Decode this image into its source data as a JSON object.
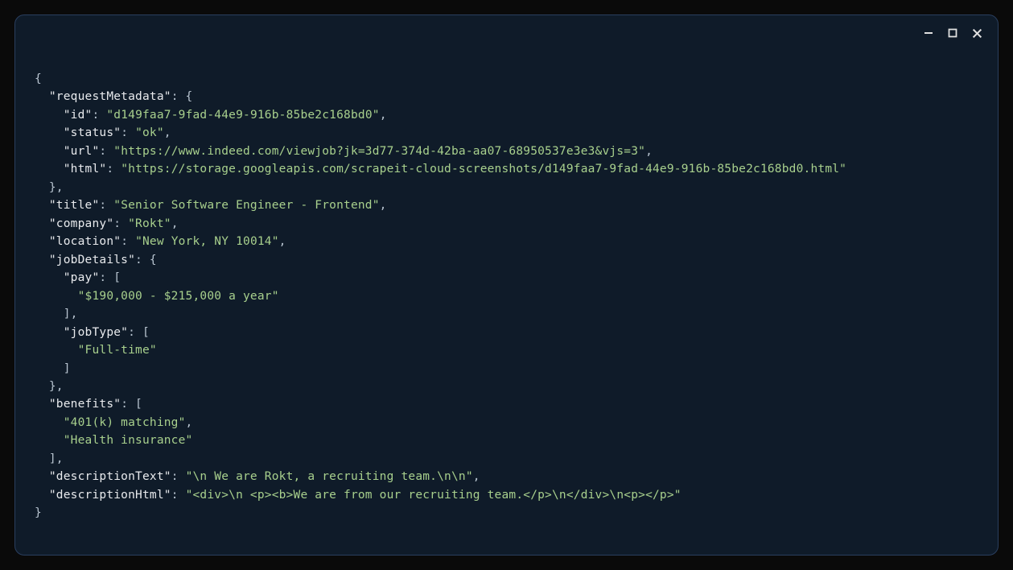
{
  "code": {
    "lines": [
      {
        "indent": 0,
        "segments": [
          {
            "type": "punct",
            "text": "{"
          }
        ]
      },
      {
        "indent": 1,
        "segments": [
          {
            "type": "key",
            "text": "\"requestMetadata\""
          },
          {
            "type": "punct",
            "text": ": {"
          }
        ]
      },
      {
        "indent": 2,
        "segments": [
          {
            "type": "key",
            "text": "\"id\""
          },
          {
            "type": "punct",
            "text": ": "
          },
          {
            "type": "string",
            "text": "\"d149faa7-9fad-44e9-916b-85be2c168bd0\""
          },
          {
            "type": "punct",
            "text": ","
          }
        ]
      },
      {
        "indent": 2,
        "segments": [
          {
            "type": "key",
            "text": "\"status\""
          },
          {
            "type": "punct",
            "text": ": "
          },
          {
            "type": "string",
            "text": "\"ok\""
          },
          {
            "type": "punct",
            "text": ","
          }
        ]
      },
      {
        "indent": 2,
        "segments": [
          {
            "type": "key",
            "text": "\"url\""
          },
          {
            "type": "punct",
            "text": ": "
          },
          {
            "type": "string",
            "text": "\"https://www.indeed.com/viewjob?jk=3d77-374d-42ba-aa07-68950537e3e3&vjs=3\""
          },
          {
            "type": "punct",
            "text": ","
          }
        ]
      },
      {
        "indent": 2,
        "segments": [
          {
            "type": "key",
            "text": "\"html\""
          },
          {
            "type": "punct",
            "text": ": "
          },
          {
            "type": "string",
            "text": "\"https://storage.googleapis.com/scrapeit-cloud-screenshots/d149faa7-9fad-44e9-916b-85be2c168bd0.html\""
          }
        ]
      },
      {
        "indent": 1,
        "segments": [
          {
            "type": "punct",
            "text": "},"
          }
        ]
      },
      {
        "indent": 1,
        "segments": [
          {
            "type": "key",
            "text": "\"title\""
          },
          {
            "type": "punct",
            "text": ": "
          },
          {
            "type": "string",
            "text": "\"Senior Software Engineer - Frontend\""
          },
          {
            "type": "punct",
            "text": ","
          }
        ]
      },
      {
        "indent": 1,
        "segments": [
          {
            "type": "key",
            "text": "\"company\""
          },
          {
            "type": "punct",
            "text": ": "
          },
          {
            "type": "string",
            "text": "\"Rokt\""
          },
          {
            "type": "punct",
            "text": ","
          }
        ]
      },
      {
        "indent": 1,
        "segments": [
          {
            "type": "key",
            "text": "\"location\""
          },
          {
            "type": "punct",
            "text": ": "
          },
          {
            "type": "string",
            "text": "\"New York, NY 10014\""
          },
          {
            "type": "punct",
            "text": ","
          }
        ]
      },
      {
        "indent": 1,
        "segments": [
          {
            "type": "key",
            "text": "\"jobDetails\""
          },
          {
            "type": "punct",
            "text": ": {"
          }
        ]
      },
      {
        "indent": 2,
        "segments": [
          {
            "type": "key",
            "text": "\"pay\""
          },
          {
            "type": "punct",
            "text": ": ["
          }
        ]
      },
      {
        "indent": 3,
        "segments": [
          {
            "type": "string",
            "text": "\"$190,000 - $215,000 a year\""
          }
        ]
      },
      {
        "indent": 2,
        "segments": [
          {
            "type": "punct",
            "text": "],"
          }
        ]
      },
      {
        "indent": 2,
        "segments": [
          {
            "type": "key",
            "text": "\"jobType\""
          },
          {
            "type": "punct",
            "text": ": ["
          }
        ]
      },
      {
        "indent": 3,
        "segments": [
          {
            "type": "string",
            "text": "\"Full-time\""
          }
        ]
      },
      {
        "indent": 2,
        "segments": [
          {
            "type": "punct",
            "text": "]"
          }
        ]
      },
      {
        "indent": 1,
        "segments": [
          {
            "type": "punct",
            "text": "},"
          }
        ]
      },
      {
        "indent": 1,
        "segments": [
          {
            "type": "key",
            "text": "\"benefits\""
          },
          {
            "type": "punct",
            "text": ": ["
          }
        ]
      },
      {
        "indent": 2,
        "segments": [
          {
            "type": "string",
            "text": "\"401(k) matching\""
          },
          {
            "type": "punct",
            "text": ","
          }
        ]
      },
      {
        "indent": 2,
        "segments": [
          {
            "type": "string",
            "text": "\"Health insurance\""
          }
        ]
      },
      {
        "indent": 1,
        "segments": [
          {
            "type": "punct",
            "text": "],"
          }
        ]
      },
      {
        "indent": 1,
        "segments": [
          {
            "type": "key",
            "text": "\"descriptionText\""
          },
          {
            "type": "punct",
            "text": ": "
          },
          {
            "type": "string",
            "text": "\"\\n We are Rokt, a recruiting team.\\n\\n\""
          },
          {
            "type": "punct",
            "text": ","
          }
        ]
      },
      {
        "indent": 1,
        "segments": [
          {
            "type": "key",
            "text": "\"descriptionHtml\""
          },
          {
            "type": "punct",
            "text": ": "
          },
          {
            "type": "string",
            "text": "\"<div>\\n <p><b>We are from our recruiting team.</p>\\n</div>\\n<p></p>\""
          }
        ]
      },
      {
        "indent": 0,
        "segments": [
          {
            "type": "punct",
            "text": "}"
          }
        ]
      }
    ]
  }
}
